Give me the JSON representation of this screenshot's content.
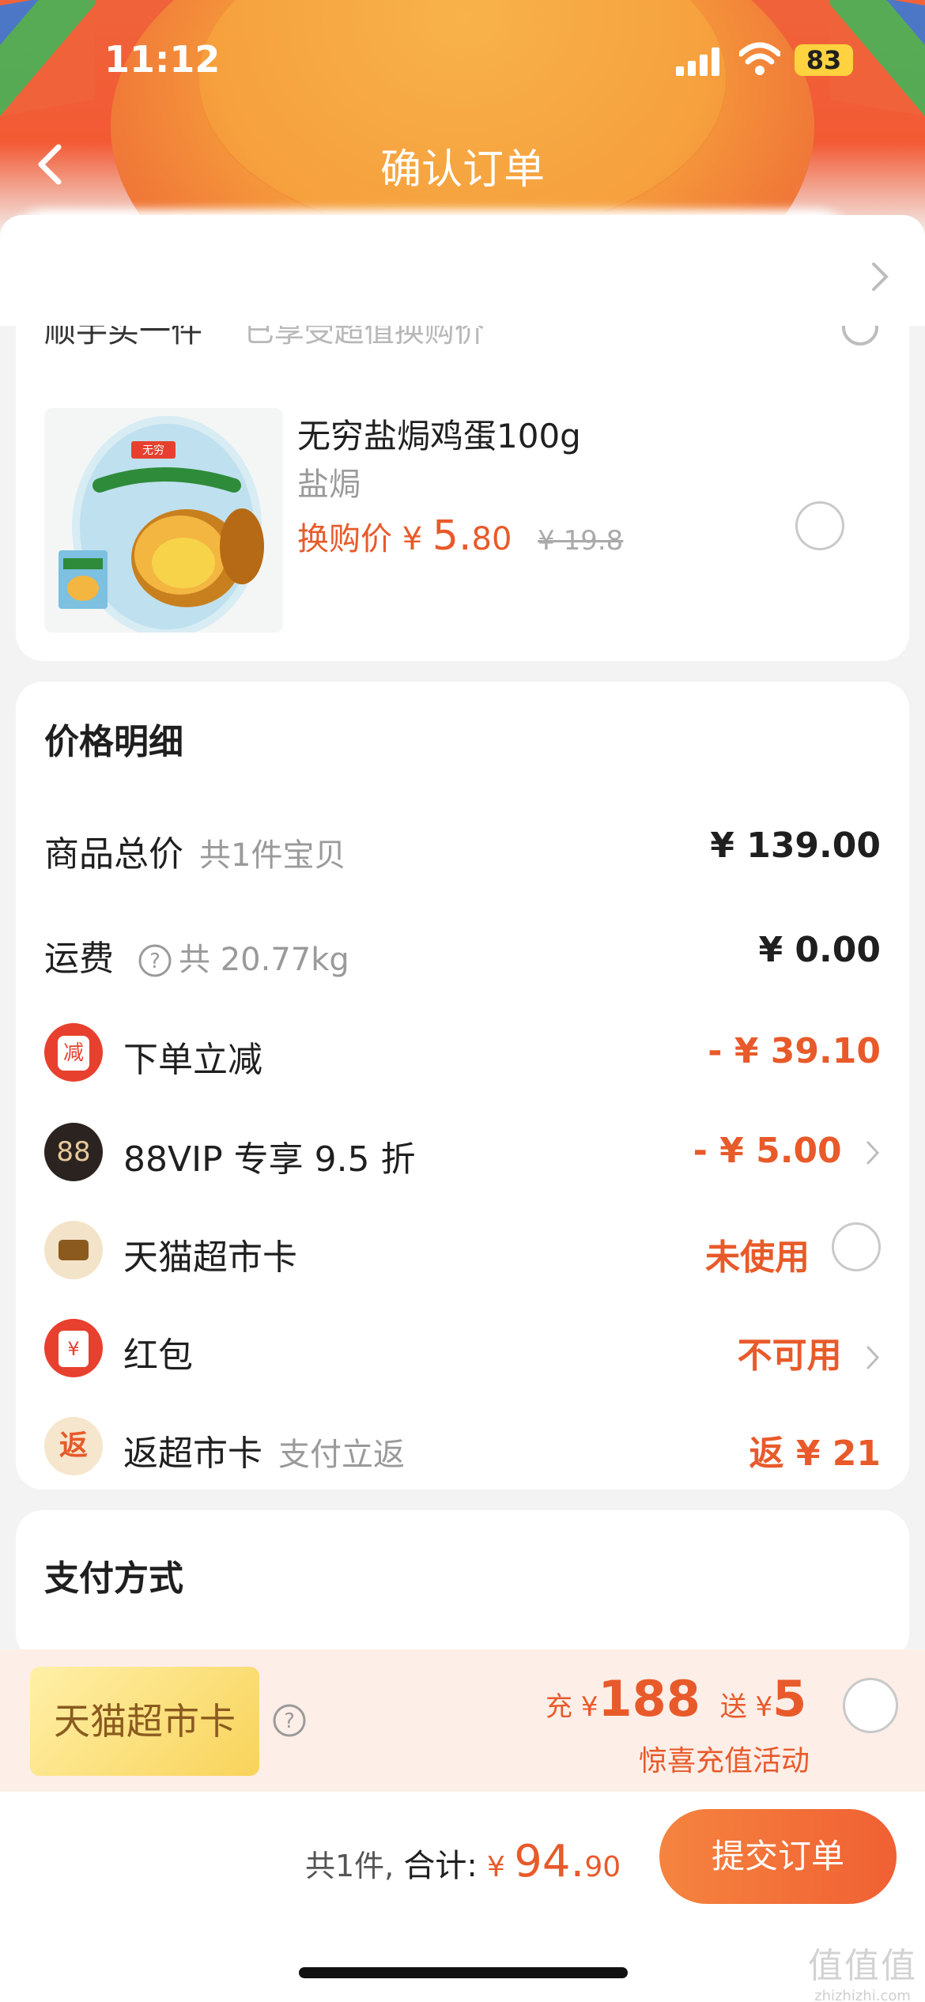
{
  "status_bar": {
    "time": "11:12",
    "battery": "83"
  },
  "nav": {
    "title": "确认订单"
  },
  "product": {
    "cut_off_title": "顺手买一件",
    "cut_off_hint": "已享受超值换购价",
    "image_brand": "无穷",
    "name": "无穷盐焗鸡蛋100g",
    "spec": "盐焗",
    "swap_label": "换购价",
    "currency": "¥",
    "price_int": "5.",
    "price_dec": "80",
    "original_price": "¥ 19.8"
  },
  "price_detail": {
    "title": "价格明细",
    "rows": [
      {
        "label": "商品总价",
        "sub": "共1件宝贝",
        "value": "¥ 139.00"
      },
      {
        "label": "运费",
        "sub": "共 20.77kg",
        "value": "¥ 0.00"
      },
      {
        "icon_text": "减",
        "label": "下单立减",
        "value": "- ¥ 39.10"
      },
      {
        "icon_text": "88",
        "label": "88VIP 专享 9.5 折",
        "value": "- ¥ 5.00"
      },
      {
        "label": "天猫超市卡",
        "value": "未使用"
      },
      {
        "icon_text": "¥",
        "label": "红包",
        "value": "不可用"
      },
      {
        "icon_text": "返",
        "label": "返超市卡",
        "sub": "支付立返",
        "value": "返 ¥ 21"
      }
    ]
  },
  "payment": {
    "title": "支付方式"
  },
  "promo": {
    "card_label": "天猫超市卡",
    "charge_word": "充",
    "currency": "¥",
    "charge_amount": "188",
    "gift_word": "送",
    "gift_amount": "5",
    "subtitle": "惊喜充值活动"
  },
  "footer": {
    "count": "共1件,",
    "total_label": "合计:",
    "currency": "¥",
    "total_int": "94.",
    "total_dec": "90",
    "submit_label": "提交订单"
  },
  "watermark": {
    "line1": "值值值",
    "line2": "zhizhizhi.com"
  },
  "colors": {
    "accent": "#e85a2a",
    "header": "#f0633a",
    "button": "#f06033"
  }
}
